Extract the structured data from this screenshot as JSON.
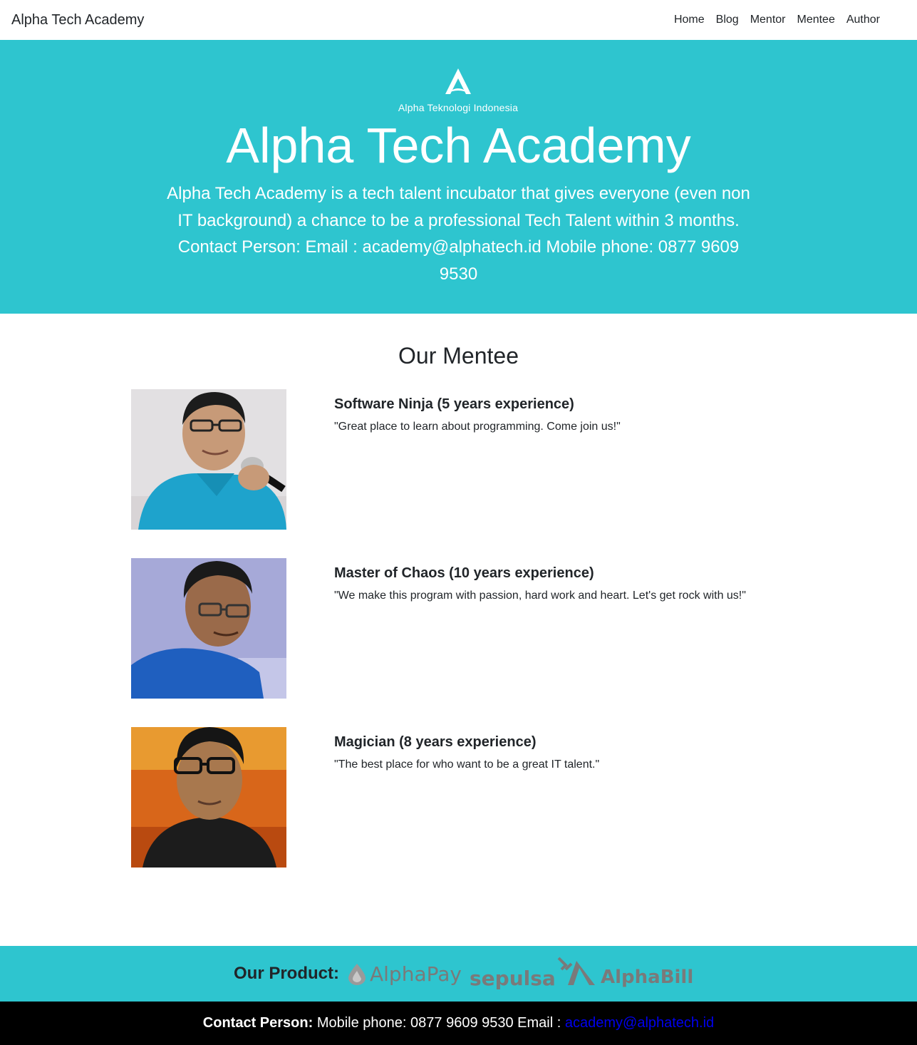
{
  "navbar": {
    "brand": "Alpha Tech Academy",
    "links": [
      "Home",
      "Blog",
      "Mentor",
      "Mentee",
      "Author"
    ]
  },
  "hero": {
    "logo_text": "Alpha Teknologi Indonesia",
    "title": "Alpha Tech Academy",
    "lead": "Alpha Tech Academy is a tech talent incubator that gives everyone (even non IT background) a chance to be a professional Tech Talent within 3 months. Contact Person: Email : academy@alphatech.id Mobile phone: 0877 9609 9530"
  },
  "mentees": {
    "heading": "Our Mentee",
    "items": [
      {
        "title": "Software Ninja (5 years experience)",
        "quote": "\"Great place to learn about programming. Come join us!\""
      },
      {
        "title": "Master of Chaos (10 years experience)",
        "quote": "\"We make this program with passion, hard work and heart. Let's get rock with us!\""
      },
      {
        "title": "Magician (8 years experience)",
        "quote": "\"The best place for who want to be a great IT talent.\""
      }
    ]
  },
  "products": {
    "label": "Our Product:",
    "items": [
      "AlphaPay",
      "sepulsa",
      "AlphaBill"
    ]
  },
  "footer": {
    "contact_label": "Contact Person:",
    "contact_text": " Mobile phone: 0877 9609 9530 Email : ",
    "email": "academy@alphatech.id"
  },
  "colors": {
    "accent": "#2ec5cf",
    "footer_bg": "#000000",
    "link": "#0000ee"
  }
}
